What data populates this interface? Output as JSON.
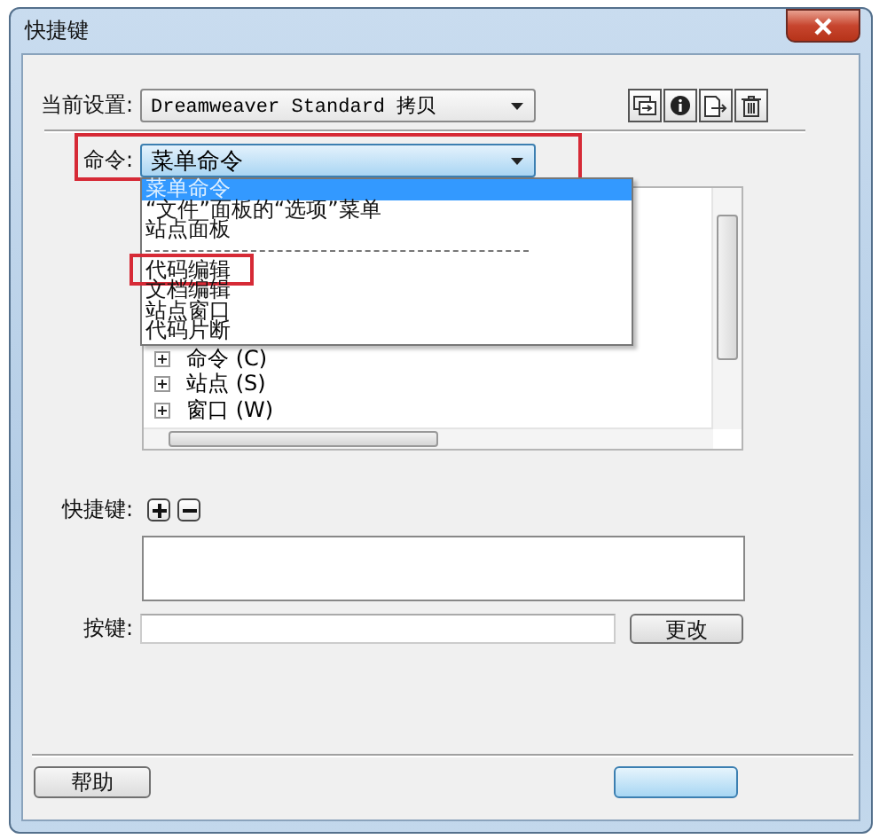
{
  "window": {
    "title": "快捷键"
  },
  "current_set": {
    "label": "当前设置:",
    "value": "Dreamweaver Standard 拷贝"
  },
  "toolbar_buttons": [
    {
      "kind": "duplicate"
    },
    {
      "kind": "info"
    },
    {
      "kind": "export"
    },
    {
      "kind": "delete"
    }
  ],
  "command": {
    "label": "命令:",
    "value": "菜单命令",
    "annotated": true
  },
  "command_menu": [
    {
      "kind": "item",
      "label": "菜单命令",
      "selected": true,
      "annotated": false
    },
    {
      "kind": "item",
      "label": "“文件”面板的“选项”菜单",
      "selected": false,
      "annotated": false
    },
    {
      "kind": "item",
      "label": "站点面板",
      "selected": false,
      "annotated": false
    },
    {
      "kind": "separator"
    },
    {
      "kind": "item",
      "label": "代码编辑",
      "selected": false,
      "annotated": true
    },
    {
      "kind": "item",
      "label": "文档编辑",
      "selected": false,
      "annotated": false
    },
    {
      "kind": "item",
      "label": "站点窗口",
      "selected": false,
      "annotated": false
    },
    {
      "kind": "item",
      "label": "代码片断",
      "selected": false,
      "annotated": false
    }
  ],
  "tree": [
    {
      "label": "命令 (C)",
      "expanded": false
    },
    {
      "label": "站点 (S)",
      "expanded": false
    },
    {
      "label": "窗口 (W)",
      "expanded": false
    }
  ],
  "shortcuts": {
    "label": "快捷键:"
  },
  "key": {
    "label": "按键:",
    "button": "更改"
  },
  "buttons": {
    "help": "帮助"
  }
}
